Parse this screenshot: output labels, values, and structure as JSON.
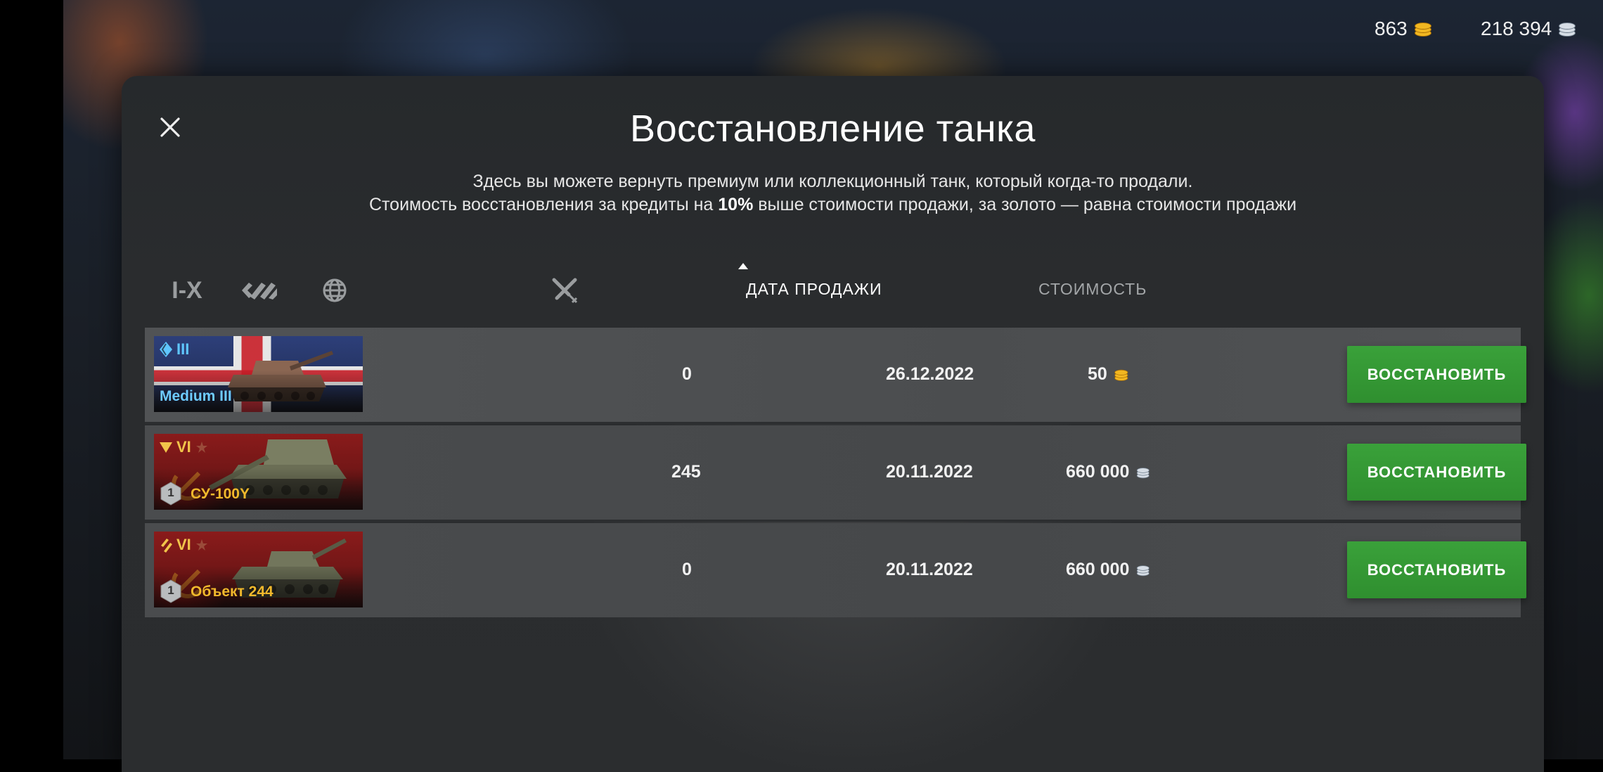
{
  "topbar": {
    "gold": "863",
    "credits": "218 394",
    "gold_icon": "gold-coins-icon",
    "credits_icon": "silver-coins-icon"
  },
  "dialog": {
    "title": "Восстановление танка",
    "subtitle_line1": "Здесь вы можете вернуть премиум или коллекционный танк, который когда-то продали.",
    "subtitle_line2_pre": "Стоимость восстановления за кредиты на ",
    "subtitle_line2_bold": "10%",
    "subtitle_line2_post": " выше стоимости продажи, за золото — равна стоимости продажи",
    "close_icon": "close-icon"
  },
  "filters": {
    "tier_filter": "I-X",
    "type_filter_icon": "vehicle-type-icon",
    "nation_filter_icon": "globe-icon",
    "battles_column_icon": "crossed-swords-icon"
  },
  "columns": {
    "sale_date": "ДАТА ПРОДАЖИ",
    "cost": "СТОИМОСТЬ",
    "sort_indicator_icon": "sort-ascending-icon"
  },
  "colors": {
    "accent_green": "#34992f",
    "premium_gold": "#f1b92c",
    "collectible_blue": "#5fc6ff"
  },
  "rows": [
    {
      "tier": "III",
      "tank_name": "Medium III",
      "nation": "uk",
      "battles": "0",
      "sale_date": "26.12.2022",
      "cost": "50",
      "currency_icon": "gold-coins-icon",
      "button": "ВОССТАНОВИТЬ"
    },
    {
      "tier": "VI",
      "tank_name": "СУ-100Y",
      "nation": "ussr",
      "mastery": "1",
      "battles": "245",
      "sale_date": "20.11.2022",
      "cost": "660 000",
      "currency_icon": "silver-coins-icon",
      "button": "ВОССТАНОВИТЬ"
    },
    {
      "tier": "VI",
      "tank_name": "Объект 244",
      "nation": "ussr",
      "mastery": "1",
      "battles": "0",
      "sale_date": "20.11.2022",
      "cost": "660 000",
      "currency_icon": "silver-coins-icon",
      "button": "ВОССТАНОВИТЬ"
    }
  ]
}
